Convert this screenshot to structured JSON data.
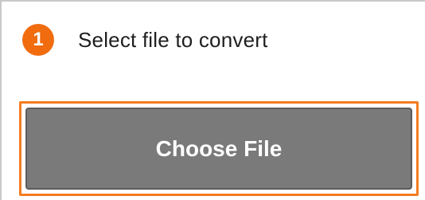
{
  "step": {
    "number": "1",
    "title": "Select file to convert"
  },
  "upload": {
    "button_label": "Choose File"
  },
  "colors": {
    "accent": "#f06c0f",
    "button_bg": "#7a7a7a",
    "frame_border": "#f47c20"
  }
}
